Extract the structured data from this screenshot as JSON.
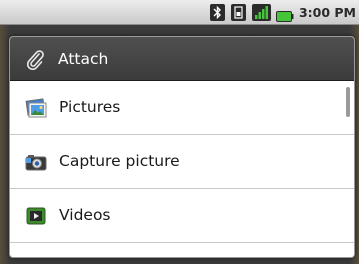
{
  "status_bar": {
    "time": "3:00 PM",
    "icons": [
      "bluetooth-icon",
      "sim-icon",
      "signal-icon",
      "battery-icon"
    ]
  },
  "dialog": {
    "title": "Attach",
    "title_icon": "paperclip-icon",
    "items": [
      {
        "label": "Pictures",
        "icon": "pictures-icon"
      },
      {
        "label": "Capture picture",
        "icon": "camera-icon"
      },
      {
        "label": "Videos",
        "icon": "videos-icon"
      }
    ]
  },
  "colors": {
    "title_bar": "#444444",
    "list_bg": "#ffffff",
    "battery": "#46c43a"
  }
}
